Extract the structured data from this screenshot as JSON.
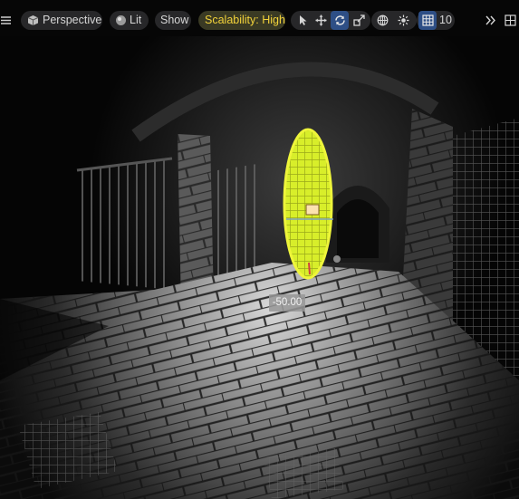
{
  "viewport": {
    "mode_label": "Perspective",
    "view_mode_label": "Lit",
    "show_label": "Show",
    "scalability_label": "Scalability: High",
    "grid_snap_value": "10",
    "measurement": "-50.00"
  },
  "toolbar": {
    "icons": [
      "hamburger-menu-icon",
      "perspective-cube-icon",
      "lit-sphere-icon",
      "select-cursor-icon",
      "translate-icon",
      "rotate-icon",
      "scale-icon",
      "world-globe-icon",
      "surface-snap-icon",
      "grid-snap-icon",
      "more-chevron-icon",
      "layout-icon"
    ],
    "active_tools": [
      "rotate",
      "grid-snap"
    ]
  },
  "colors": {
    "toolbar_bg": "#2a2a2c",
    "accent_blue": "#2e4f86",
    "scalability_text": "#f2d23a",
    "gizmo_yellow": "#e6f23a"
  }
}
